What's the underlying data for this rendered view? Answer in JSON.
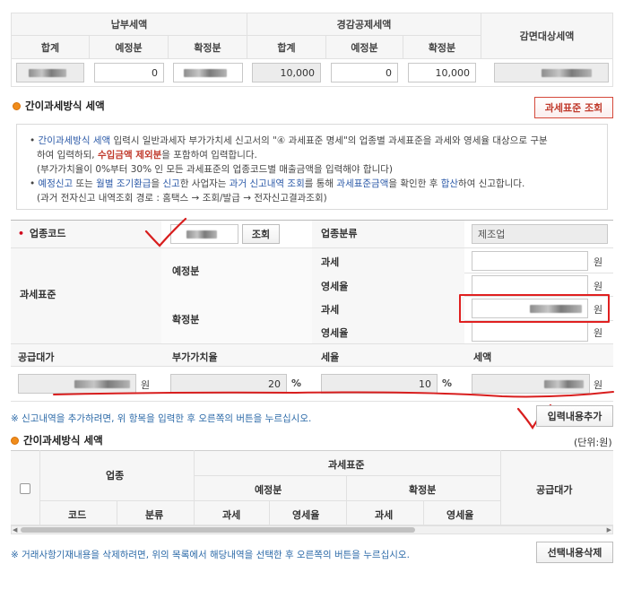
{
  "top_table": {
    "groups": [
      "납부세액",
      "경감공제세액",
      "감면대상세액"
    ],
    "columns": [
      "합계",
      "예정분",
      "확정분",
      "합계",
      "예정분",
      "확정분"
    ],
    "values": {
      "paid_expected": "0",
      "reduction_total": "10,000",
      "reduction_expected": "0",
      "reduction_confirmed": "10,000"
    }
  },
  "simple_section": {
    "title": "간이과세방식 세액",
    "lookup_button": "과세표준 조회"
  },
  "notice": {
    "b1_a": "간이과세방식 세액",
    "b1_b": " 입력시 일반과세자 부가가치세 신고서의 \"④ 과세표준 명세\"의 업종별 과세표준을 과세와 영세율 대상으로 구분",
    "b1_c": "하여 입력하되, ",
    "b1_d": "수입금액 제외분",
    "b1_e": "을 포함하여 입력합니다.",
    "b1_f": "(부가가치율이 0%부터 30% 인 모든 과세표준의 업종코드별 매출금액을 입력해야 합니다)",
    "b2_a": "예정신고",
    "b2_b": " 또는 ",
    "b2_c": "월별 조기환급",
    "b2_d": "을 ",
    "b2_e": "신고",
    "b2_f": "한 사업자는 ",
    "b2_g": "과거 신고내역 조회",
    "b2_h": "를 통해 ",
    "b2_i": "과세표준금액",
    "b2_j": "을 확인한 후 ",
    "b2_k": "합산",
    "b2_l": "하여 신고합니다.",
    "b2_m": "(과거 전자신고 내역조회 경로 : 홈택스 → 조회/발급 → 전자신고결과조회)"
  },
  "form": {
    "industry_code_label": "업종코드",
    "lookup_btn": "조회",
    "industry_class_label": "업종분류",
    "industry_class_value": "제조업",
    "tax_base_label": "과세표준",
    "expected_label": "예정분",
    "confirmed_label": "확정분",
    "taxable_label": "과세",
    "zero_rate_label": "영세율",
    "won": "원",
    "supply_label": "공급대가",
    "vat_rate_label": "부가가치율",
    "tax_rate_label": "세율",
    "tax_amount_label": "세액",
    "vat_rate_value": "20",
    "tax_rate_value": "10",
    "percent": "%"
  },
  "tip1": "※ 신고내역을 추가하려면, 위 항목을 입력한 후 오른쪽의 버튼을 누르십시오.",
  "add_button": "입력내용추가",
  "list_section": {
    "title": "간이과세방식 세액",
    "unit": "(단위:원)",
    "headers": {
      "industry": "업종",
      "tax_base": "과세표준",
      "expected": "예정분",
      "confirmed": "확정분",
      "supply": "공급대가",
      "code": "코드",
      "class": "분류",
      "taxable": "과세",
      "zero": "영세율"
    }
  },
  "tip2": "※ 거래사항기재내용을 삭제하려면, 위의 목록에서 해당내역을 선택한 후 오른쪽의 버튼을 누르십시오.",
  "delete_button": "선택내용삭제"
}
